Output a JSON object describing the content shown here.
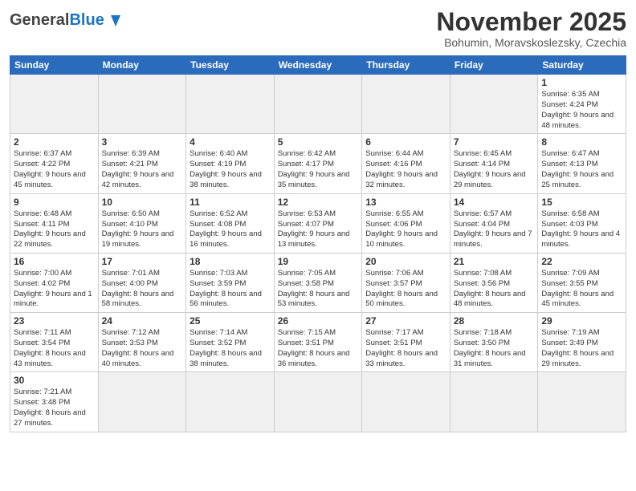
{
  "header": {
    "logo": {
      "text_general": "General",
      "text_blue": "Blue"
    },
    "title": "November 2025",
    "location": "Bohumin, Moravskoslezsky, Czechia"
  },
  "weekdays": [
    "Sunday",
    "Monday",
    "Tuesday",
    "Wednesday",
    "Thursday",
    "Friday",
    "Saturday"
  ],
  "weeks": [
    [
      {
        "day": "",
        "info": ""
      },
      {
        "day": "",
        "info": ""
      },
      {
        "day": "",
        "info": ""
      },
      {
        "day": "",
        "info": ""
      },
      {
        "day": "",
        "info": ""
      },
      {
        "day": "",
        "info": ""
      },
      {
        "day": "1",
        "info": "Sunrise: 6:35 AM\nSunset: 4:24 PM\nDaylight: 9 hours\nand 48 minutes."
      }
    ],
    [
      {
        "day": "2",
        "info": "Sunrise: 6:37 AM\nSunset: 4:22 PM\nDaylight: 9 hours\nand 45 minutes."
      },
      {
        "day": "3",
        "info": "Sunrise: 6:39 AM\nSunset: 4:21 PM\nDaylight: 9 hours\nand 42 minutes."
      },
      {
        "day": "4",
        "info": "Sunrise: 6:40 AM\nSunset: 4:19 PM\nDaylight: 9 hours\nand 38 minutes."
      },
      {
        "day": "5",
        "info": "Sunrise: 6:42 AM\nSunset: 4:17 PM\nDaylight: 9 hours\nand 35 minutes."
      },
      {
        "day": "6",
        "info": "Sunrise: 6:44 AM\nSunset: 4:16 PM\nDaylight: 9 hours\nand 32 minutes."
      },
      {
        "day": "7",
        "info": "Sunrise: 6:45 AM\nSunset: 4:14 PM\nDaylight: 9 hours\nand 29 minutes."
      },
      {
        "day": "8",
        "info": "Sunrise: 6:47 AM\nSunset: 4:13 PM\nDaylight: 9 hours\nand 25 minutes."
      }
    ],
    [
      {
        "day": "9",
        "info": "Sunrise: 6:48 AM\nSunset: 4:11 PM\nDaylight: 9 hours\nand 22 minutes."
      },
      {
        "day": "10",
        "info": "Sunrise: 6:50 AM\nSunset: 4:10 PM\nDaylight: 9 hours\nand 19 minutes."
      },
      {
        "day": "11",
        "info": "Sunrise: 6:52 AM\nSunset: 4:08 PM\nDaylight: 9 hours\nand 16 minutes."
      },
      {
        "day": "12",
        "info": "Sunrise: 6:53 AM\nSunset: 4:07 PM\nDaylight: 9 hours\nand 13 minutes."
      },
      {
        "day": "13",
        "info": "Sunrise: 6:55 AM\nSunset: 4:06 PM\nDaylight: 9 hours\nand 10 minutes."
      },
      {
        "day": "14",
        "info": "Sunrise: 6:57 AM\nSunset: 4:04 PM\nDaylight: 9 hours\nand 7 minutes."
      },
      {
        "day": "15",
        "info": "Sunrise: 6:58 AM\nSunset: 4:03 PM\nDaylight: 9 hours\nand 4 minutes."
      }
    ],
    [
      {
        "day": "16",
        "info": "Sunrise: 7:00 AM\nSunset: 4:02 PM\nDaylight: 9 hours\nand 1 minute."
      },
      {
        "day": "17",
        "info": "Sunrise: 7:01 AM\nSunset: 4:00 PM\nDaylight: 8 hours\nand 58 minutes."
      },
      {
        "day": "18",
        "info": "Sunrise: 7:03 AM\nSunset: 3:59 PM\nDaylight: 8 hours\nand 56 minutes."
      },
      {
        "day": "19",
        "info": "Sunrise: 7:05 AM\nSunset: 3:58 PM\nDaylight: 8 hours\nand 53 minutes."
      },
      {
        "day": "20",
        "info": "Sunrise: 7:06 AM\nSunset: 3:57 PM\nDaylight: 8 hours\nand 50 minutes."
      },
      {
        "day": "21",
        "info": "Sunrise: 7:08 AM\nSunset: 3:56 PM\nDaylight: 8 hours\nand 48 minutes."
      },
      {
        "day": "22",
        "info": "Sunrise: 7:09 AM\nSunset: 3:55 PM\nDaylight: 8 hours\nand 45 minutes."
      }
    ],
    [
      {
        "day": "23",
        "info": "Sunrise: 7:11 AM\nSunset: 3:54 PM\nDaylight: 8 hours\nand 43 minutes."
      },
      {
        "day": "24",
        "info": "Sunrise: 7:12 AM\nSunset: 3:53 PM\nDaylight: 8 hours\nand 40 minutes."
      },
      {
        "day": "25",
        "info": "Sunrise: 7:14 AM\nSunset: 3:52 PM\nDaylight: 8 hours\nand 38 minutes."
      },
      {
        "day": "26",
        "info": "Sunrise: 7:15 AM\nSunset: 3:51 PM\nDaylight: 8 hours\nand 36 minutes."
      },
      {
        "day": "27",
        "info": "Sunrise: 7:17 AM\nSunset: 3:51 PM\nDaylight: 8 hours\nand 33 minutes."
      },
      {
        "day": "28",
        "info": "Sunrise: 7:18 AM\nSunset: 3:50 PM\nDaylight: 8 hours\nand 31 minutes."
      },
      {
        "day": "29",
        "info": "Sunrise: 7:19 AM\nSunset: 3:49 PM\nDaylight: 8 hours\nand 29 minutes."
      }
    ],
    [
      {
        "day": "30",
        "info": "Sunrise: 7:21 AM\nSunset: 3:48 PM\nDaylight: 8 hours\nand 27 minutes."
      },
      {
        "day": "",
        "info": ""
      },
      {
        "day": "",
        "info": ""
      },
      {
        "day": "",
        "info": ""
      },
      {
        "day": "",
        "info": ""
      },
      {
        "day": "",
        "info": ""
      },
      {
        "day": "",
        "info": ""
      }
    ]
  ]
}
